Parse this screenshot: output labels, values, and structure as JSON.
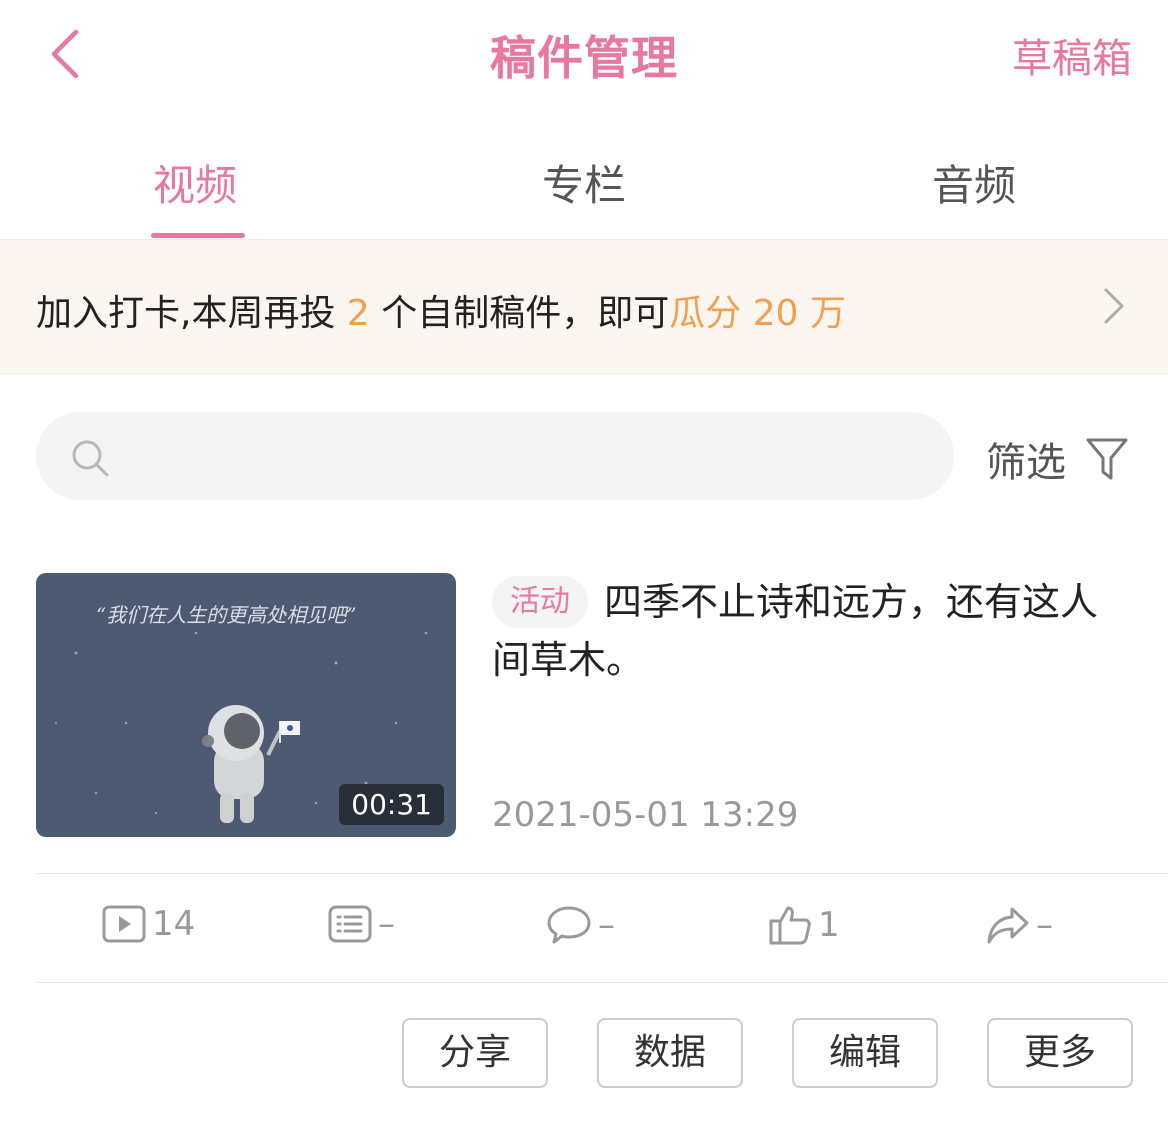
{
  "header": {
    "title": "稿件管理",
    "drafts_label": "草稿箱"
  },
  "tabs": [
    {
      "label": "视频",
      "active": true
    },
    {
      "label": "专栏",
      "active": false
    },
    {
      "label": "音频",
      "active": false
    }
  ],
  "banner": {
    "part1": "加入打卡,本周再投 ",
    "count": "2",
    "part2": " 个自制稿件，即可",
    "highlight": "瓜分 20 万"
  },
  "search": {
    "placeholder": "",
    "value": ""
  },
  "filter": {
    "label": "筛选"
  },
  "video": {
    "tag": "活动",
    "title": "四季不止诗和远方，还有这人间草木。",
    "duration": "00:31",
    "date": "2021-05-01 13:29",
    "thumbnail_text": "“我们在人生的更高处相见吧”"
  },
  "stats": {
    "plays": "14",
    "danmaku": "–",
    "comments": "–",
    "likes": "1",
    "shares": "–"
  },
  "actions": {
    "share": "分享",
    "data": "数据",
    "edit": "编辑",
    "more": "更多"
  },
  "colors": {
    "accent": "#e8789c",
    "highlight": "#f0a050",
    "banner_bg": "#fcf6f0"
  }
}
